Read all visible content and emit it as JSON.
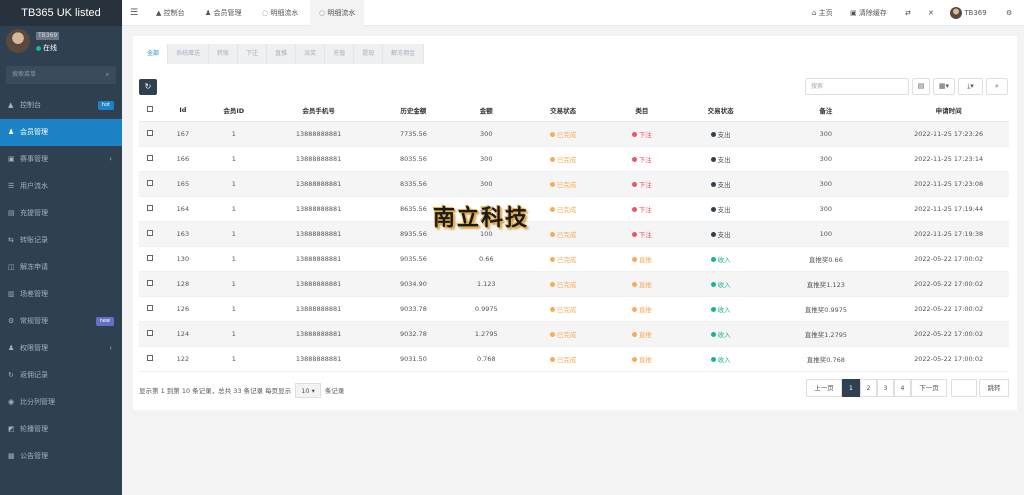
{
  "app": {
    "title": "TB365 UK listed"
  },
  "profile": {
    "name": "TB369",
    "status": "在线"
  },
  "sidebar_search": {
    "placeholder": "搜索菜单"
  },
  "menu": [
    {
      "label": "控制台",
      "icon": "dashboard-icon",
      "badge": "hot"
    },
    {
      "label": "会员管理",
      "icon": "users-icon",
      "active": true
    },
    {
      "label": "赛事管理",
      "icon": "calendar-icon",
      "arrow": "‹"
    },
    {
      "label": "用户流水",
      "icon": "list-icon"
    },
    {
      "label": "充提管理",
      "icon": "wallet-icon"
    },
    {
      "label": "转账记录",
      "icon": "transfer-icon"
    },
    {
      "label": "解冻申请",
      "icon": "unlock-icon"
    },
    {
      "label": "场差管理",
      "icon": "chart-icon"
    },
    {
      "label": "常规管理",
      "icon": "cog-icon",
      "badge": "new"
    },
    {
      "label": "权限管理",
      "icon": "users-icon",
      "arrow": "‹"
    },
    {
      "label": "返佣记录",
      "icon": "refresh-icon"
    },
    {
      "label": "比分列管理",
      "icon": "circle-icon"
    },
    {
      "label": "轮播管理",
      "icon": "image-icon"
    },
    {
      "label": "公告管理",
      "icon": "notice-icon"
    }
  ],
  "topbar": {
    "tabs": [
      "控制台",
      "会员管理",
      "明细流水",
      "明细流水"
    ],
    "right": [
      "主页",
      "清除缓存",
      "TB369"
    ]
  },
  "subtabs": [
    "全部",
    "系统赠送",
    "转账",
    "下注",
    "直推",
    "派奖",
    "充值",
    "提现",
    "解冻佣金"
  ],
  "search": {
    "placeholder": "搜索"
  },
  "table": {
    "headers": [
      "Id",
      "会员ID",
      "会员手机号",
      "历史金额",
      "金额",
      "交易状态",
      "类目",
      "交易状态",
      "备注",
      "申请时间"
    ],
    "rows": [
      [
        "167",
        "1",
        "13888888881",
        "7735.56",
        "300",
        "已完成",
        "下注",
        "支出",
        "300",
        "2022-11-25 17:23:26"
      ],
      [
        "166",
        "1",
        "13888888881",
        "8035.56",
        "300",
        "已完成",
        "下注",
        "支出",
        "300",
        "2022-11-25 17:23:14"
      ],
      [
        "165",
        "1",
        "13888888881",
        "8335.56",
        "300",
        "已完成",
        "下注",
        "支出",
        "300",
        "2022-11-25 17:23:08"
      ],
      [
        "164",
        "1",
        "13888888881",
        "8635.56",
        "300",
        "已完成",
        "下注",
        "支出",
        "300",
        "2022-11-25 17:19:44"
      ],
      [
        "163",
        "1",
        "13888888881",
        "8935.56",
        "100",
        "已完成",
        "下注",
        "支出",
        "100",
        "2022-11-25 17:19:38"
      ],
      [
        "130",
        "1",
        "13888888881",
        "9035.56",
        "0.66",
        "已完成",
        "直推",
        "收入",
        "直推奖0.66",
        "2022-05-22 17:00:02"
      ],
      [
        "128",
        "1",
        "13888888881",
        "9034.90",
        "1.123",
        "已完成",
        "直推",
        "收入",
        "直推奖1.123",
        "2022-05-22 17:00:02"
      ],
      [
        "126",
        "1",
        "13888888881",
        "9033.78",
        "0.9975",
        "已完成",
        "直推",
        "收入",
        "直推奖0.9975",
        "2022-05-22 17:00:02"
      ],
      [
        "124",
        "1",
        "13888888881",
        "9032.78",
        "1.2795",
        "已完成",
        "直推",
        "收入",
        "直推奖1.2795",
        "2022-05-22 17:00:02"
      ],
      [
        "122",
        "1",
        "13888888881",
        "9031.50",
        "0.768",
        "已完成",
        "直推",
        "收入",
        "直推奖0.768",
        "2022-05-22 17:00:02"
      ]
    ]
  },
  "pagination": {
    "info_prefix": "显示第 1 到第 10 条记录，总共 33 条记录 每页显示",
    "page_size": "10",
    "info_suffix": "条记录",
    "prev": "上一页",
    "pages": [
      "1",
      "2",
      "3",
      "4"
    ],
    "next": "下一页",
    "jump": "跳转"
  },
  "watermark": "南立科技",
  "colors": {
    "sidebar": "#2f4050",
    "accent": "#1c84c6",
    "done": "#f8ac59",
    "bet": "#ed5565",
    "income": "#1ab394"
  }
}
